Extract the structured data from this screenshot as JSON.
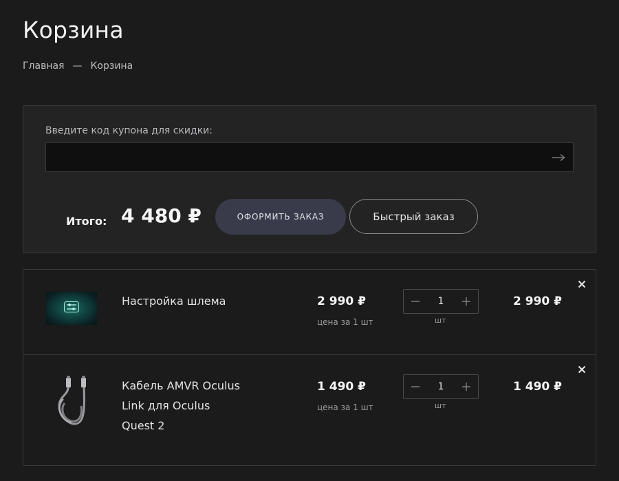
{
  "page": {
    "title": "Корзина",
    "breadcrumb": {
      "home": "Главная",
      "separator": "—",
      "current": "Корзина"
    }
  },
  "coupon": {
    "label": "Введите код купона для скидки:",
    "value": "",
    "placeholder": ""
  },
  "summary": {
    "total_label": "Итого:",
    "total_value": "4 480 ₽",
    "order_button": "ОФОРМИТЬ ЗАКАЗ",
    "quick_button": "Быстрый заказ"
  },
  "items": [
    {
      "name": "Настройка шлема",
      "unit_price": "2 990 ₽",
      "unit_caption": "цена за 1 шт",
      "quantity": "1",
      "unit": "шт",
      "line_total": "2 990 ₽",
      "image_icon": "settings-sliders-icon"
    },
    {
      "name_lines": [
        "Кабель AMVR Oculus",
        "Link для Oculus",
        "Quest 2"
      ],
      "unit_price": "1 490 ₽",
      "unit_caption": "цена за 1 шт",
      "quantity": "1",
      "unit": "шт",
      "line_total": "1 490 ₽",
      "image_icon": "usb-cable-icon"
    }
  ],
  "colors": {
    "background": "#1b1b1c",
    "panel": "#232324",
    "border": "#3a3a3c",
    "accent_button": "#3a3b4a"
  }
}
